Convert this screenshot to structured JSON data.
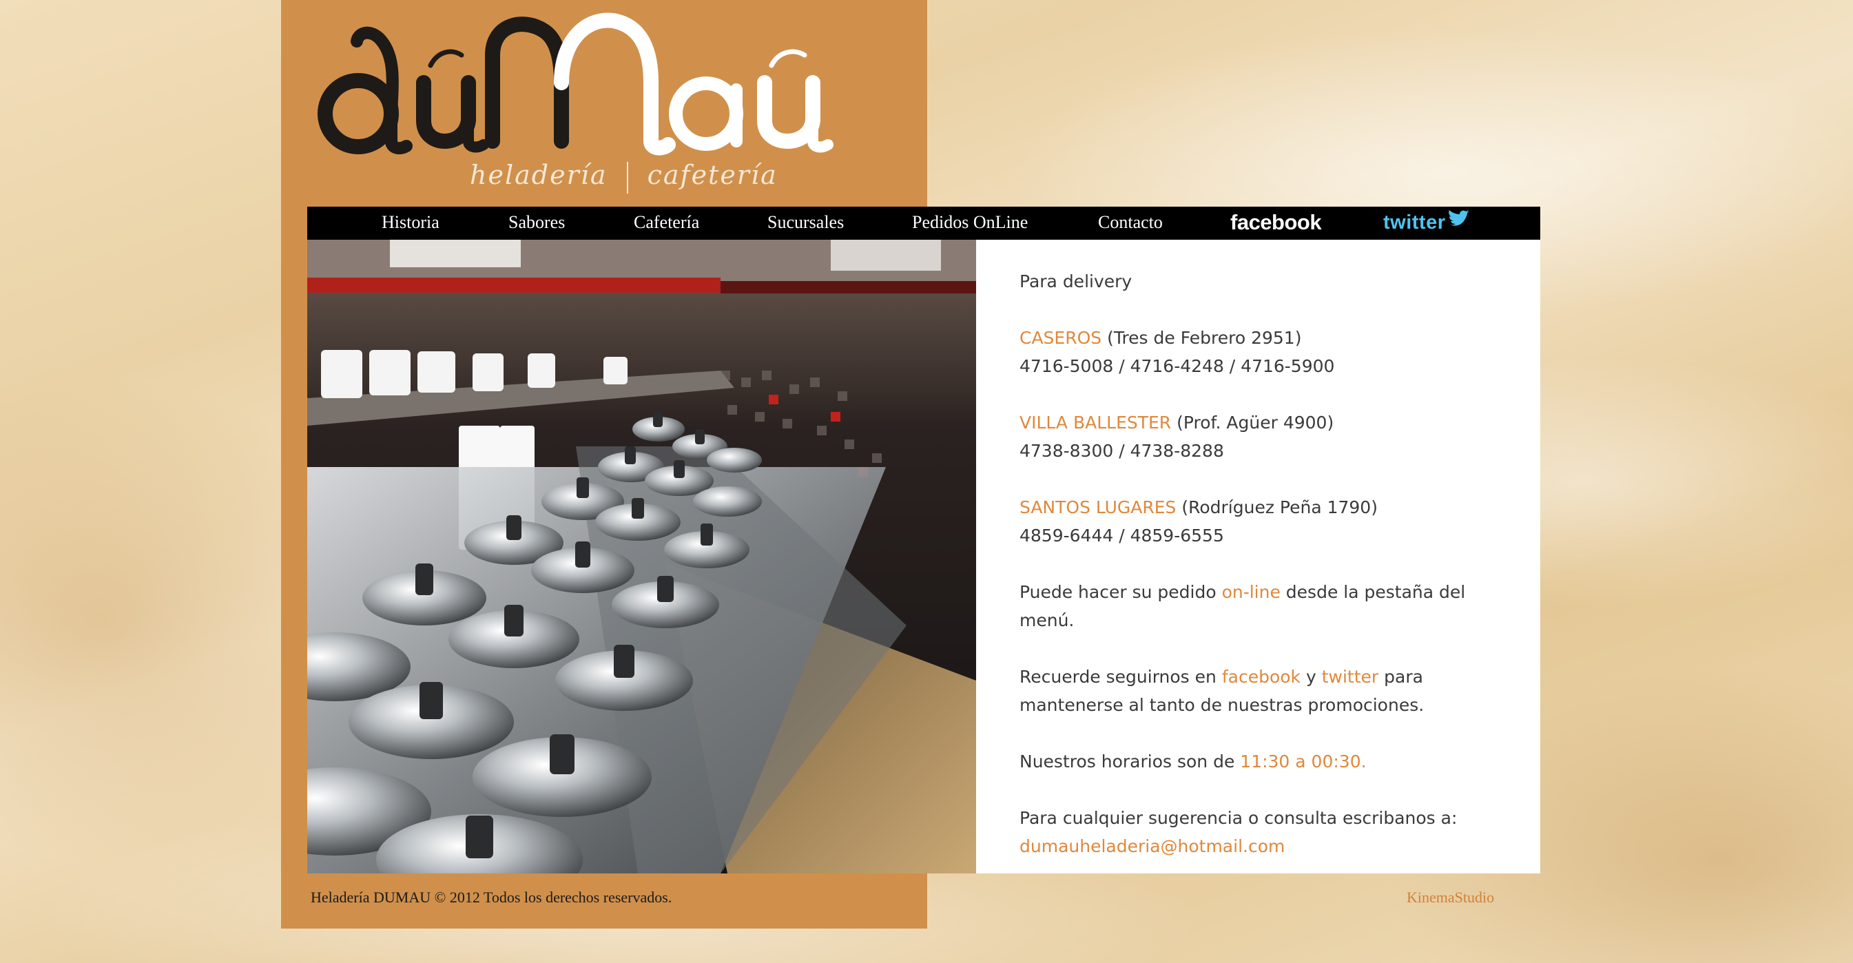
{
  "brand": {
    "logo_text": "dúMaú",
    "subtitle_left": "heladería",
    "subtitle_right": "cafetería",
    "panel_color": "#d0904b",
    "accent_color": "#e0883a"
  },
  "nav": {
    "items": [
      {
        "label": "Historia"
      },
      {
        "label": "Sabores"
      },
      {
        "label": "Cafetería"
      },
      {
        "label": "Sucursales"
      },
      {
        "label": "Pedidos OnLine"
      },
      {
        "label": "Contacto"
      }
    ],
    "facebook_label": "facebook",
    "twitter_label": "twitter"
  },
  "photo": {
    "icon": "ice-cream-counter-photo"
  },
  "content": {
    "intro": "Para delivery",
    "branches": [
      {
        "name": "CASEROS",
        "address": "(Tres de Febrero 2951)",
        "phones": "4716-5008 / 4716-4248 / 4716-5900"
      },
      {
        "name": "VILLA BALLESTER",
        "address": "(Prof. Agüer 4900)",
        "phones": "4738-8300 / 4738-8288"
      },
      {
        "name": "SANTOS LUGARES",
        "address": "(Rodríguez Peña 1790)",
        "phones": "4859-6444 / 4859-6555"
      }
    ],
    "online": {
      "before": "Puede hacer su pedido ",
      "link": "on-line",
      "after": " desde la pestaña del menú."
    },
    "social": {
      "before": "Recuerde seguirnos en ",
      "facebook": "facebook",
      "middle": " y ",
      "twitter": "twitter",
      "after": " para mantenerse al tanto de nuestras promociones."
    },
    "hours": {
      "before": "Nuestros horarios son de ",
      "value": "11:30 a 00:30."
    },
    "contact": {
      "text": "Para cualquier sugerencia o consulta escribanos a:",
      "email": "dumauheladeria@hotmail.com"
    }
  },
  "footer": {
    "copyright": "Heladería DUMAU © 2012 Todos los derechos reservados.",
    "credit": "KinemaStudio"
  }
}
